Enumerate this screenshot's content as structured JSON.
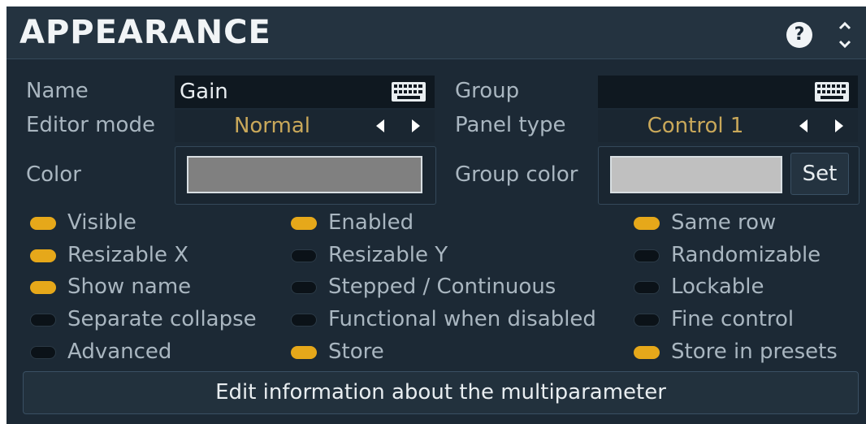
{
  "header": {
    "title": "APPEARANCE",
    "help_label": "?"
  },
  "name": {
    "label": "Name",
    "value": "Gain"
  },
  "group": {
    "label": "Group",
    "value": ""
  },
  "editor_mode": {
    "label": "Editor mode",
    "value": "Normal"
  },
  "panel_type": {
    "label": "Panel type",
    "value": "Control 1"
  },
  "color": {
    "label": "Color",
    "swatch": "#808080"
  },
  "group_color": {
    "label": "Group color",
    "swatch": "#c0c0c0",
    "set_label": "Set"
  },
  "toggles": {
    "visible": {
      "label": "Visible",
      "on": true
    },
    "enabled": {
      "label": "Enabled",
      "on": true
    },
    "same_row": {
      "label": "Same row",
      "on": true
    },
    "resizable_x": {
      "label": "Resizable X",
      "on": true
    },
    "resizable_y": {
      "label": "Resizable Y",
      "on": false
    },
    "randomizable": {
      "label": "Randomizable",
      "on": false
    },
    "show_name": {
      "label": "Show name",
      "on": true
    },
    "stepped": {
      "label": "Stepped / Continuous",
      "on": false
    },
    "lockable": {
      "label": "Lockable",
      "on": false
    },
    "separate_collapse": {
      "label": "Separate collapse",
      "on": false
    },
    "functional_disabled": {
      "label": "Functional when disabled",
      "on": false
    },
    "fine_control": {
      "label": "Fine control",
      "on": false
    },
    "advanced": {
      "label": "Advanced",
      "on": false
    },
    "store": {
      "label": "Store",
      "on": true
    },
    "store_presets": {
      "label": "Store in presets",
      "on": true
    }
  },
  "edit_button_label": "Edit information about the multiparameter",
  "colors": {
    "toggle_on": "#e6a81a",
    "toggle_off": "#0b1218",
    "select_text": "#c9a85a"
  }
}
